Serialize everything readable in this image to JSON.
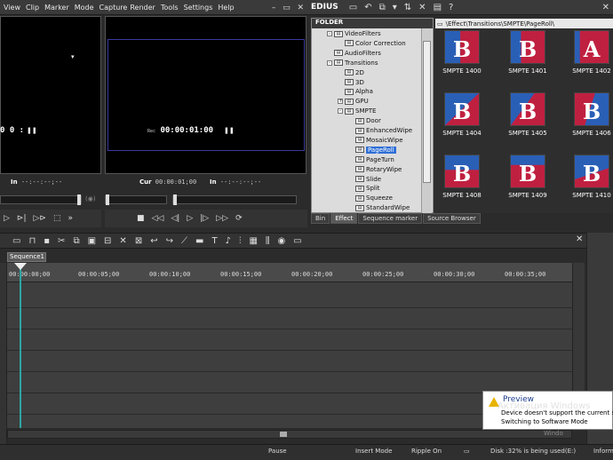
{
  "menu": [
    "View",
    "Clip",
    "Marker",
    "Mode",
    "Capture",
    "Render",
    "Tools",
    "Settings",
    "Help"
  ],
  "window_controls": [
    "–",
    "▭",
    "✕"
  ],
  "player": {
    "tc_label": "●●",
    "tc_value": "",
    "in_label": "In",
    "in_value": "--:--:--;--"
  },
  "recorder": {
    "tc_label": "Rec",
    "tc_value": "00:00:01:00",
    "cur_label": "Cur",
    "cur_value": "00:00:01;00",
    "in_label": "In",
    "in_value": "--:--:--;--"
  },
  "app_name": "EDIUS",
  "folder": {
    "header": "FOLDER",
    "items": [
      {
        "label": "VideoFilters",
        "expand": "-"
      },
      {
        "label": "Color Correction",
        "expand": ""
      },
      {
        "label": "AudioFilters",
        "expand": ""
      },
      {
        "label": "Transitions",
        "expand": "-"
      },
      {
        "label": "2D",
        "expand": ""
      },
      {
        "label": "3D",
        "expand": ""
      },
      {
        "label": "Alpha",
        "expand": ""
      },
      {
        "label": "GPU",
        "expand": "+"
      },
      {
        "label": "SMPTE",
        "expand": "-"
      },
      {
        "label": "Door",
        "expand": ""
      },
      {
        "label": "EnhancedWipe",
        "expand": ""
      },
      {
        "label": "MosaicWipe",
        "expand": ""
      },
      {
        "label": "PageRoll",
        "expand": ""
      },
      {
        "label": "PageTurn",
        "expand": ""
      },
      {
        "label": "RotaryWipe",
        "expand": ""
      },
      {
        "label": "Slide",
        "expand": ""
      },
      {
        "label": "Split",
        "expand": ""
      },
      {
        "label": "Squeeze",
        "expand": ""
      },
      {
        "label": "StandardWipe",
        "expand": ""
      }
    ]
  },
  "path": "\\Effect\\Transitions\\SMPTE\\PageRoll\\",
  "effects": [
    {
      "name": "SMPTE 1400",
      "glyph": "B"
    },
    {
      "name": "SMPTE 1401",
      "glyph": "B"
    },
    {
      "name": "SMPTE 1402",
      "glyph": "A"
    },
    {
      "name": "SMPTE 1404",
      "glyph": "B"
    },
    {
      "name": "SMPTE 1405",
      "glyph": "B"
    },
    {
      "name": "SMPTE 1406",
      "glyph": "B"
    },
    {
      "name": "SMPTE 1408",
      "glyph": "B"
    },
    {
      "name": "SMPTE 1409",
      "glyph": "B"
    },
    {
      "name": "SMPTE 1410",
      "glyph": "B"
    }
  ],
  "tabs": [
    "Bin",
    "Effect",
    "Sequence marker",
    "Source Browser"
  ],
  "active_tab": "Effect",
  "sequence": "Sequence1",
  "ruler": [
    "00:00:00;00",
    "00:00:05;00",
    "00:00:10;00",
    "00:00:15;00",
    "00:00:20;00",
    "00:00:25;00",
    "00:00:30;00",
    "00:00:35;00"
  ],
  "status": {
    "pause": "Pause",
    "insert": "Insert Mode",
    "ripple": "Ripple On",
    "disk": "Disk :32% is being used(E:)",
    "info": "Inform"
  },
  "toast": {
    "title": "Preview",
    "line1": "Device doesn't support the current s",
    "line2": "Switching to Software Mode"
  },
  "watermark": "Активация Windows",
  "watermark2": "Windo",
  "colors": {
    "accent": "#2f6fd6",
    "cursor": "#2fa6a6",
    "monitor_frame": "#3a3aa0"
  }
}
